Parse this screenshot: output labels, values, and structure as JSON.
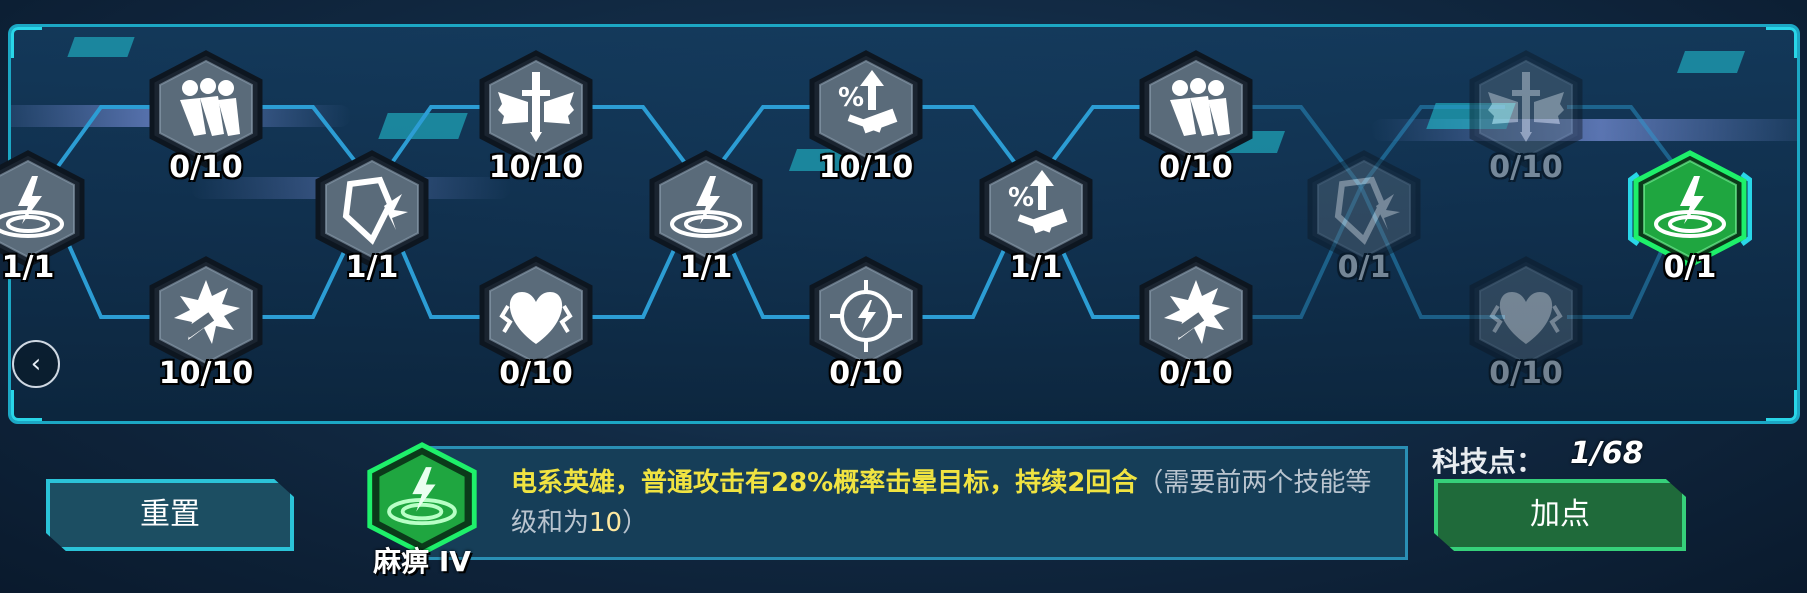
{
  "nodes": [
    {
      "id": "n0",
      "icon": "lightning-ripple-icon",
      "level": "1/1"
    },
    {
      "id": "n1",
      "icon": "charging-soldiers-icon",
      "level": "0/10"
    },
    {
      "id": "n2",
      "icon": "hammer-impact-icon",
      "level": "10/10"
    },
    {
      "id": "n3",
      "icon": "broken-shield-icon",
      "level": "1/1"
    },
    {
      "id": "n4",
      "icon": "winged-sword-icon",
      "level": "10/10"
    },
    {
      "id": "n5",
      "icon": "shattered-heart-icon",
      "level": "0/10"
    },
    {
      "id": "n6",
      "icon": "lightning-ripple-icon",
      "level": "1/1"
    },
    {
      "id": "n7",
      "icon": "percent-up-hammer-icon",
      "level": "10/10"
    },
    {
      "id": "n8",
      "icon": "lightning-crosshair-icon",
      "level": "0/10"
    },
    {
      "id": "n9",
      "icon": "percent-up-hammer-icon",
      "level": "1/1"
    },
    {
      "id": "n10",
      "icon": "charging-soldiers-icon",
      "level": "0/10"
    },
    {
      "id": "n11",
      "icon": "hammer-impact-icon",
      "level": "0/10"
    },
    {
      "id": "n12",
      "icon": "broken-shield-icon",
      "level": "0/1"
    },
    {
      "id": "n13",
      "icon": "winged-sword-icon",
      "level": "0/10"
    },
    {
      "id": "n14",
      "icon": "shattered-heart-icon",
      "level": "0/10"
    },
    {
      "id": "n15",
      "icon": "lightning-ripple-icon",
      "level": "0/1"
    }
  ],
  "nav": {
    "prev_arrow": "‹"
  },
  "buttons": {
    "reset_label": "重置",
    "add_point_label": "加点"
  },
  "tech_points": {
    "label": "科技点：",
    "value": "1/68"
  },
  "selected_skill": {
    "name": "麻痹 IV",
    "icon": "lightning-ripple-icon",
    "description_main": "电系英雄，普通攻击有28%概率击晕目标，持续2回合",
    "description_req_a": "（需要前两个技能等级和为",
    "description_req_num": "10",
    "description_req_b": "）"
  },
  "colors": {
    "accent_cyan": "#1ca7c4",
    "selected_green": "#22c84a",
    "add_button_green": "#1f6a3a",
    "description_yellow": "#f0e341"
  }
}
